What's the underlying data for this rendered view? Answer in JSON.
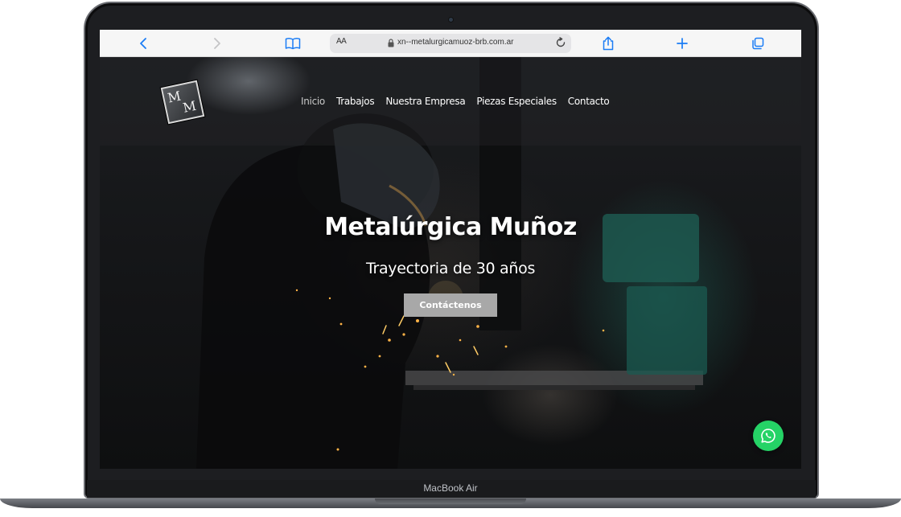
{
  "device": {
    "label": "MacBook Air"
  },
  "browser": {
    "text_size_label": "AA",
    "url": "xn--metalurgicamuoz-brb.com.ar",
    "icons": {
      "back": "chevron-left-icon",
      "forward": "chevron-right-icon",
      "bookmarks": "book-icon",
      "lock": "lock-icon",
      "reload": "reload-icon",
      "share": "share-icon",
      "new_tab": "plus-icon",
      "tabs": "tabs-icon"
    },
    "accent_color": "#1a7cf5"
  },
  "site": {
    "logo_letters": [
      "M",
      "M"
    ],
    "nav": [
      {
        "label": "Inicio",
        "active": true
      },
      {
        "label": "Trabajos",
        "active": false
      },
      {
        "label": "Nuestra Empresa",
        "active": false
      },
      {
        "label": "Piezas Especiales",
        "active": false
      },
      {
        "label": "Contacto",
        "active": false
      }
    ],
    "hero": {
      "title": "Metalúrgica Muñoz",
      "subtitle": "Trayectoria de 30 años",
      "cta_label": "Contáctenos"
    },
    "whatsapp": {
      "icon": "whatsapp-icon",
      "color": "#25d366"
    }
  }
}
